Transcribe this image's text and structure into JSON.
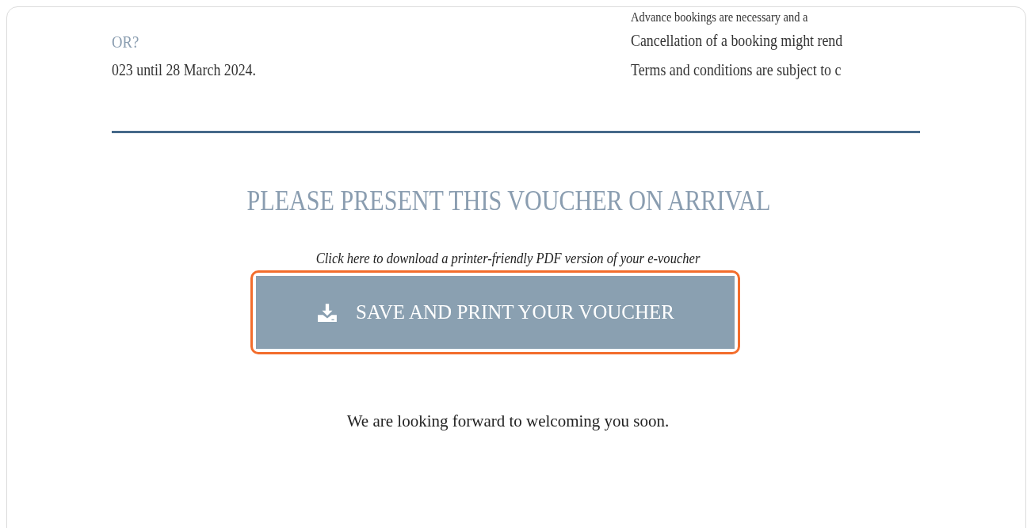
{
  "left_column": {
    "heading": "OR?",
    "text": "023 until 28 March 2024."
  },
  "right_column": {
    "lines": [
      "Advance bookings are necessary and a",
      "Cancellation of a booking might rend",
      "Terms and conditions are subject to c"
    ]
  },
  "notice": {
    "title": "PLEASE PRESENT THIS VOUCHER ON ARRIVAL"
  },
  "download": {
    "hint": "Click here to download a printer-friendly PDF version of your e-voucher",
    "button": "SAVE AND PRINT YOUR VOUCHER",
    "highlighted": true
  },
  "closing": "We are looking forward to welcoming you soon."
}
